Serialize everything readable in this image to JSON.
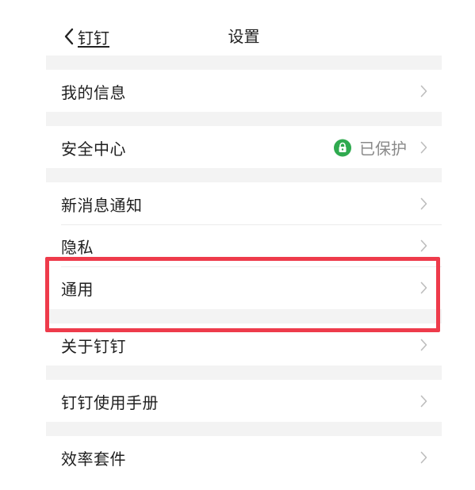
{
  "header": {
    "back_label": "钉钉",
    "title": "设置"
  },
  "menu": {
    "my_info": "我的信息",
    "security": "安全中心",
    "security_status": "已保护",
    "new_message": "新消息通知",
    "privacy": "隐私",
    "general": "通用",
    "about": "关于钉钉",
    "manual": "钉钉使用手册",
    "efficiency": "效率套件"
  },
  "colors": {
    "accent_status": "#2faa4f",
    "highlight_border": "#ee3b4b"
  }
}
